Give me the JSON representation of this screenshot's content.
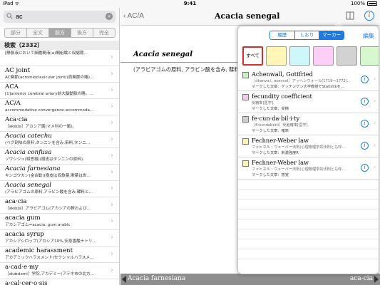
{
  "status": {
    "left": "iPad ᯤ",
    "time": "9:41",
    "battery": "100%"
  },
  "search": {
    "value": "ac",
    "clear_glyph": "×"
  },
  "modes": [
    {
      "label": "部分",
      "active": false
    },
    {
      "label": "全文",
      "active": false
    },
    {
      "label": "前方",
      "active": true
    },
    {
      "label": "後方",
      "active": false
    },
    {
      "label": "完全",
      "active": false
    }
  ],
  "results_header": "検索（2332）",
  "results": [
    {
      "hw": "",
      "sub": "[静脈液において細胞間液(a)間組織と収縮期…",
      "italic": false
    },
    {
      "hw": "AC joint",
      "sub": "AC関節(acromioclavicular joint)(肩関節の略)…",
      "italic": false
    },
    {
      "hw": "ACA",
      "sub": "[1]anterior cerebral artery前大脳動脈の略。…",
      "italic": false
    },
    {
      "hw": "AC/A",
      "sub": "accommodative convergence-accommoda…",
      "italic": false
    },
    {
      "hw": "Aca·cia",
      "sub": "［əkéɪʃə］アカシア属(マメ科の一属)。",
      "italic": false
    },
    {
      "hw": "Acacia catechu",
      "sub": "(ペグ剤味の原料,タンニンを含み,染料,タンニ…",
      "italic": true
    },
    {
      "hw": "Acacia confusa",
      "sub": "ソウシジュ(相思樹)(樹皮はタンニンの原料).",
      "italic": true
    },
    {
      "hw": "Acacia farnesiana",
      "sub": "キンゴウカン(金合歓)(樹皮は収斂薬,嗽薬は世…",
      "italic": true
    },
    {
      "hw": "Acacia senegal",
      "sub": "(アラビアゴムの原料,アラビン酸を含み,鞣料と…",
      "italic": true
    },
    {
      "hw": "aca·cia",
      "sub": "［əkéɪʃə］アラビアゴム(アカシアの幹および…",
      "italic": false
    },
    {
      "hw": "acacia gum",
      "sub": "アカシアゴム=acacia, gum arabic.",
      "italic": false
    },
    {
      "hw": "acacia syrup",
      "sub": "アカシアシロップ(アカシア10%,安息香酸ナトリ…",
      "italic": false
    },
    {
      "hw": "academic harassment",
      "sub": "アカデミックハラスメント(セクシャルハラスメ…",
      "italic": false
    },
    {
      "hw": "a·cad·e·my",
      "sub": "［əkǽdəmi］学院,アカデミー(アテネ市の北方…",
      "italic": false
    },
    {
      "hw": "a·cal·cer·o·sis",
      "sub": "［əkælsəróʊsɪs］無カルシウム症(カルシウム…",
      "italic": false
    }
  ],
  "nav": {
    "back_label": "AC/A",
    "title": "Acacia senegal"
  },
  "entry": {
    "headword": "Acacia senegal",
    "definition": "(アラビアゴムの原料, アラビン酸を含み, 鞣料と…"
  },
  "bottom": {
    "prev": "Acacia farnesiana",
    "next": "aca-cia"
  },
  "popover": {
    "tabs": [
      {
        "label": "履歴",
        "active": false
      },
      {
        "label": "しおり",
        "active": false
      },
      {
        "label": "マーカー",
        "active": true
      }
    ],
    "edit_label": "編集",
    "swatches": [
      {
        "label": "すべて",
        "color": "#ffffff"
      },
      {
        "label": "",
        "color": "#fff6b8"
      },
      {
        "label": "",
        "color": "#cdf7f9"
      },
      {
        "label": "",
        "color": "#fccff7"
      },
      {
        "label": "",
        "color": "#d2d2d2"
      },
      {
        "label": "",
        "color": "#d7f7cf"
      }
    ],
    "bookmarks": [
      {
        "color": "#c8f1c2",
        "title": "Achenwall, Gottfried",
        "pron": "［ɑ́kənvɑːl, ɑxənvɑl］アッヘンウォール(1719～1772)…",
        "marked": "マークした文章：ゲッチンゲン大学教授でStatistikを…"
      },
      {
        "color": "#f7c6f1",
        "title": "fecundity coefficient",
        "pron": "受精率[医学].",
        "marked": "マークした文章：受精"
      },
      {
        "color": "#cdcdcd",
        "title": "fe·cun·da·bil·i·ty",
        "pron": "［fiːkʌndəbɪlɪti］受胎確率[医学].",
        "marked": "マークした文章：確率"
      },
      {
        "color": "#fff3b0",
        "title": "Fechner-Weber law",
        "pron": "フェヒネル・ウェーバー法則(心理物理学的法則とも呼…",
        "marked": "マークした文章：刺激強度R"
      },
      {
        "color": "#fff3b0",
        "title": "Fechner-Weber law",
        "pron": "フェヒネル・ウェーバー法則(心理物理学的法則とも呼…",
        "marked": "マークした文章：感覚"
      }
    ],
    "info_glyph": "i",
    "chevron": "›"
  },
  "chevron": "›",
  "back_chevron": "‹"
}
